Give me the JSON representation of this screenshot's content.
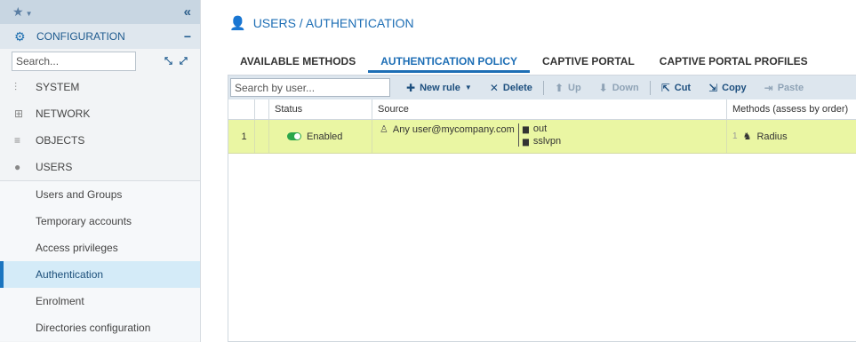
{
  "sidebar": {
    "collapse_icon": "double-chevron-left-icon",
    "config_label": "CONFIGURATION",
    "search_placeholder": "Search...",
    "sections": [
      {
        "label": "SYSTEM",
        "icon": "sliders-icon"
      },
      {
        "label": "NETWORK",
        "icon": "network-icon"
      },
      {
        "label": "OBJECTS",
        "icon": "database-icon"
      },
      {
        "label": "USERS",
        "icon": "user-icon"
      }
    ],
    "sub_items": [
      {
        "label": "Users and Groups"
      },
      {
        "label": "Temporary accounts"
      },
      {
        "label": "Access privileges"
      },
      {
        "label": "Authentication"
      },
      {
        "label": "Enrolment"
      },
      {
        "label": "Directories configuration"
      }
    ]
  },
  "main": {
    "title": "USERS / AUTHENTICATION",
    "tabs": [
      {
        "label": "AVAILABLE METHODS"
      },
      {
        "label": "AUTHENTICATION POLICY"
      },
      {
        "label": "CAPTIVE PORTAL"
      },
      {
        "label": "CAPTIVE PORTAL PROFILES"
      }
    ],
    "toolbar": {
      "search_placeholder": "Search by user...",
      "new_rule": "New rule",
      "delete": "Delete",
      "up": "Up",
      "down": "Down",
      "cut": "Cut",
      "copy": "Copy",
      "paste": "Paste"
    },
    "grid": {
      "headers": {
        "status": "Status",
        "source": "Source",
        "methods": "Methods (assess by order)"
      },
      "rows": [
        {
          "num": "1",
          "status": "Enabled",
          "source_user": "Any user@mycompany.com",
          "interfaces": [
            "out",
            "sslvpn"
          ],
          "method_index": "1",
          "method": "Radius"
        }
      ]
    }
  },
  "colors": {
    "accent": "#1d6eb5",
    "row_highlight": "#eaf6a3",
    "enabled_green": "#2aa64a",
    "toolbar_bg": "#dde6ee"
  }
}
